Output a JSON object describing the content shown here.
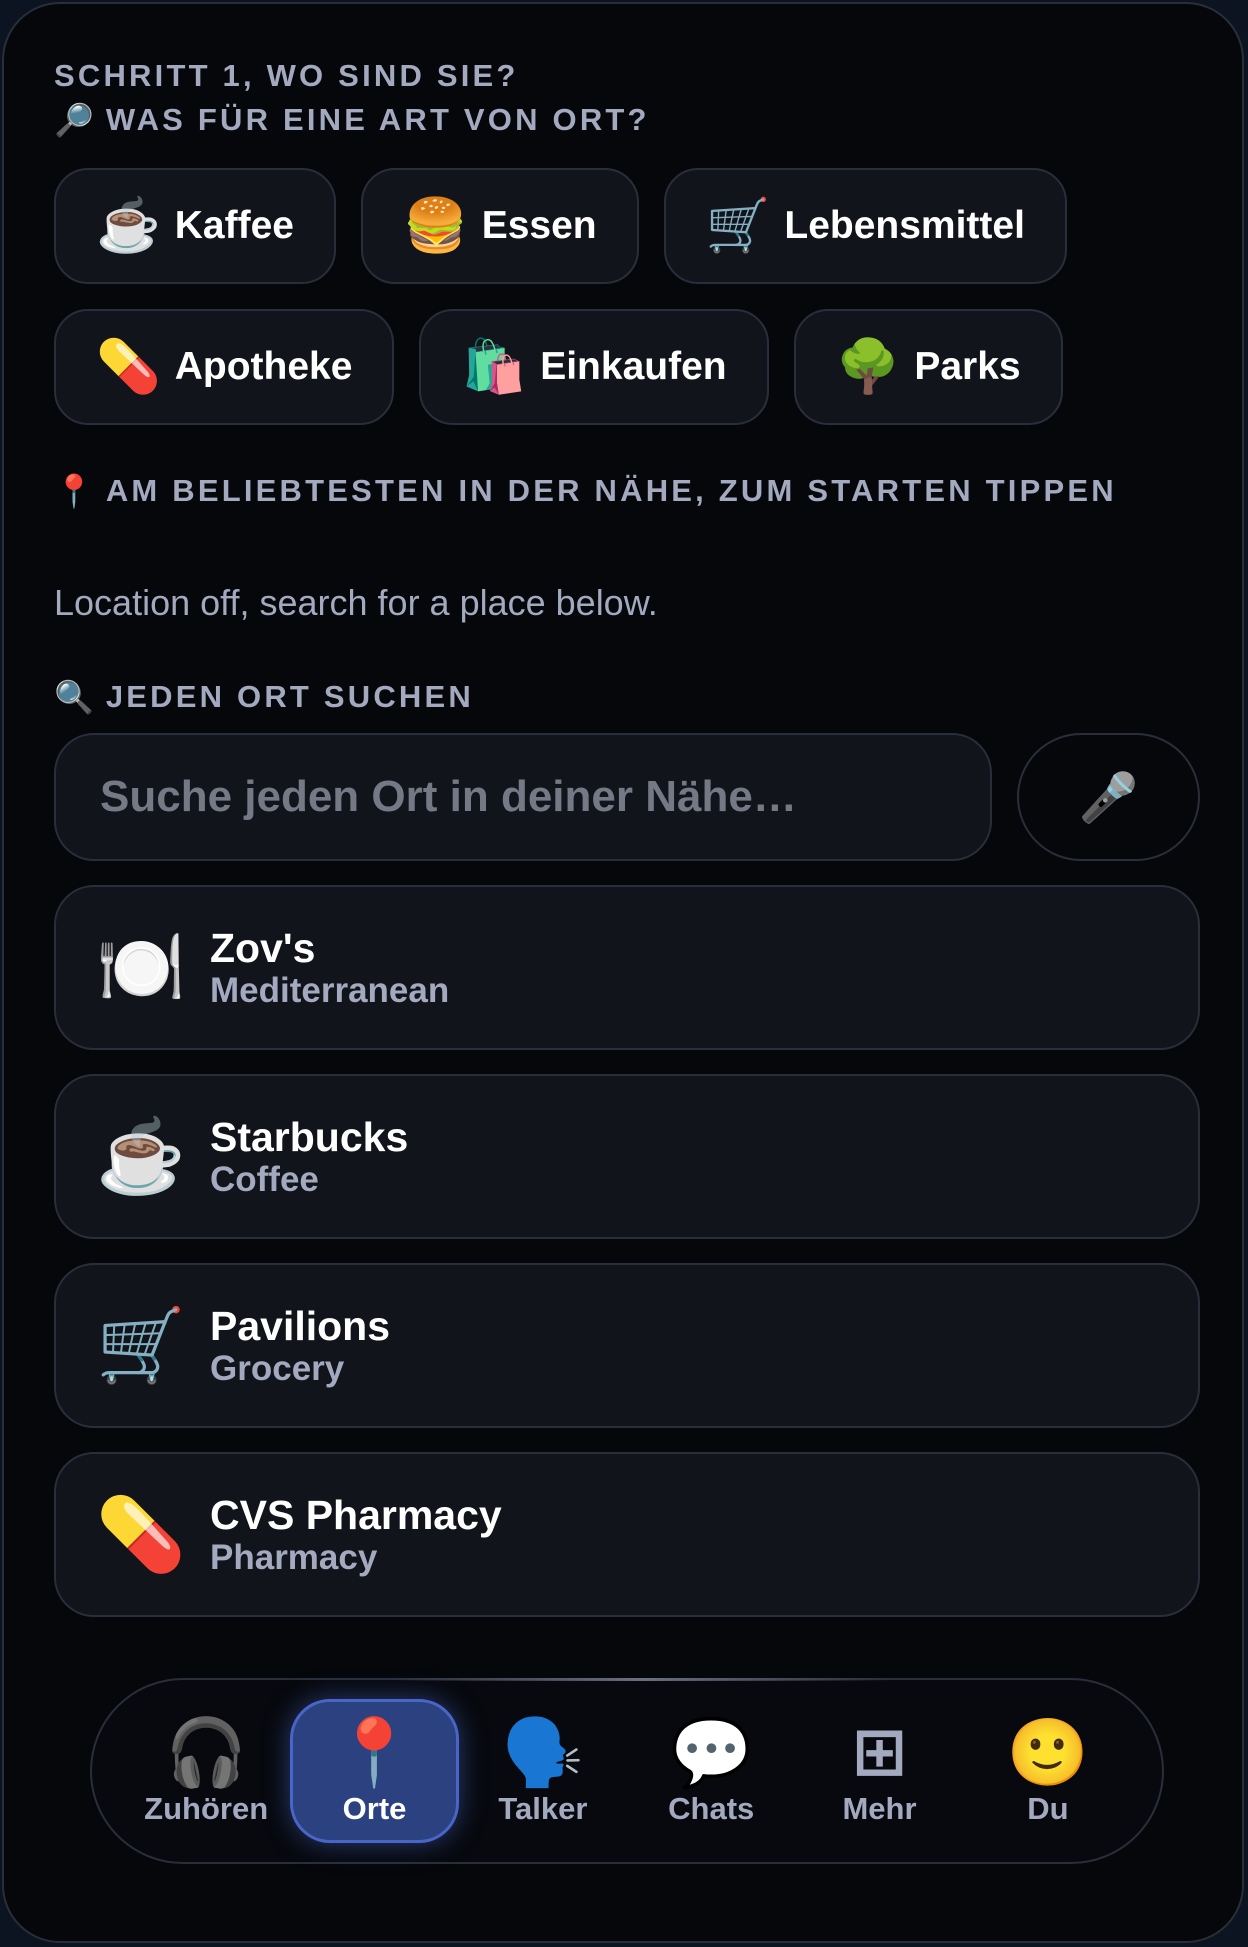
{
  "step_label": "SCHRITT 1, WO SIND SIE?",
  "category_section": {
    "icon": "🔎",
    "label": "WAS FÜR EINE ART VON ORT?"
  },
  "categories": [
    {
      "icon": "☕",
      "label": "Kaffee"
    },
    {
      "icon": "🍔",
      "label": "Essen"
    },
    {
      "icon": "🛒",
      "label": "Lebensmittel"
    },
    {
      "icon": "💊",
      "label": "Apotheke"
    },
    {
      "icon": "🛍️",
      "label": "Einkaufen"
    },
    {
      "icon": "🌳",
      "label": "Parks"
    }
  ],
  "nearby_section": {
    "icon": "📍",
    "label": "AM BELIEBTESTEN IN DER NÄHE, ZUM STARTEN TIPPEN"
  },
  "location_status": "Location off, search for a place below.",
  "search_section": {
    "icon": "🔍",
    "label": "JEDEN ORT SUCHEN"
  },
  "search": {
    "placeholder": "Suche jeden Ort in deiner Nähe…",
    "value": "",
    "mic_icon": "🎤"
  },
  "places": [
    {
      "icon": "🍽️",
      "name": "Zov's",
      "type": "Mediterranean"
    },
    {
      "icon": "☕",
      "name": "Starbucks",
      "type": "Coffee"
    },
    {
      "icon": "🛒",
      "name": "Pavilions",
      "type": "Grocery"
    },
    {
      "icon": "💊",
      "name": "CVS Pharmacy",
      "type": "Pharmacy"
    }
  ],
  "tabs": [
    {
      "icon": "🎧",
      "label": "Zuhören",
      "active": false
    },
    {
      "icon": "📍",
      "label": "Orte",
      "active": true
    },
    {
      "icon": "🗣️",
      "label": "Talker",
      "active": false
    },
    {
      "icon": "💬",
      "label": "Chats",
      "active": false
    },
    {
      "icon": "⊞",
      "label": "Mehr",
      "active": false
    },
    {
      "icon": "🙂",
      "label": "Du",
      "active": false
    }
  ],
  "colors": {
    "background": "#05070b",
    "card": "#12141c",
    "muted_text": "#a3a9be",
    "accent": "#2c4180"
  }
}
